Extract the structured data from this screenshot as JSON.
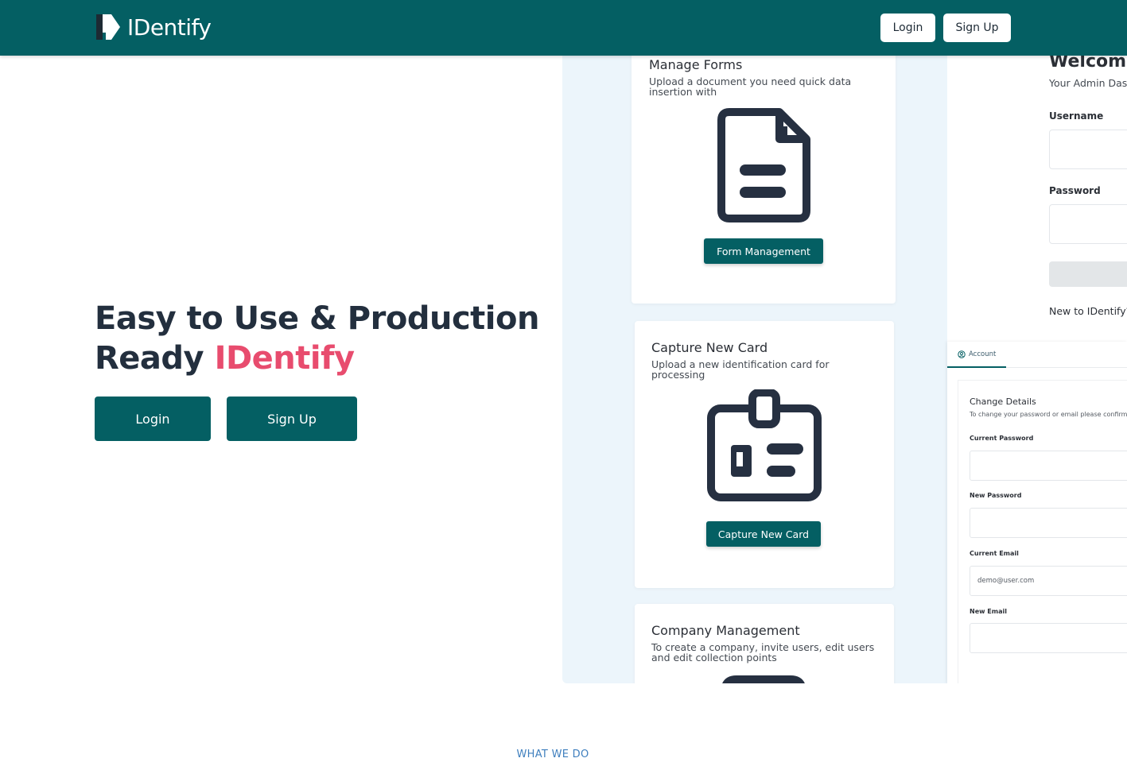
{
  "navbar": {
    "brand": "IDentify",
    "login_label": "Login",
    "signup_label": "Sign Up"
  },
  "hero": {
    "title_line1": "Easy to Use & Production",
    "title_line2_prefix": "Ready ",
    "title_accent": "IDentify",
    "login_label": "Login",
    "signup_label": "Sign Up"
  },
  "showcase": {
    "cards": [
      {
        "title": "Manage Forms",
        "description": "Upload a document you need quick data insertion with",
        "button": "Form Management",
        "icon": "document-icon"
      },
      {
        "title": "Capture New Card",
        "description": "Upload a new identification card for processing",
        "button": "Capture New Card",
        "icon": "id-card-icon"
      },
      {
        "title": "Company Management",
        "description": "To create a company, invite users, edit users and edit collection points",
        "icon": "company-icon"
      }
    ],
    "login_panel": {
      "welcome": "Welcome",
      "subtitle": "Your Admin Das",
      "username_label": "Username",
      "password_label": "Password",
      "footer": "New to IDentify?"
    },
    "account_panel": {
      "tab_label": "Account",
      "heading": "Change Details",
      "subtitle": "To change your password or email please confirm",
      "current_password_label": "Current Password",
      "new_password_label": "New Password",
      "current_email_label": "Current Email",
      "current_email_value": "demo@user.com",
      "new_email_label": "New Email"
    }
  },
  "section": {
    "what_we_do": "WHAT WE DO"
  },
  "colors": {
    "primary": "#045f63",
    "accent": "#e84c6e",
    "showcase_bg": "#ecf5fb",
    "section_label": "#3f7fbe"
  }
}
